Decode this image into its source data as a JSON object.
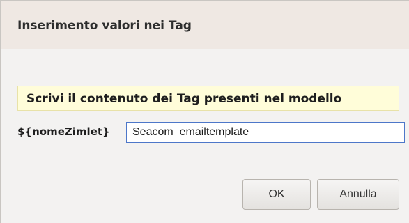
{
  "dialog": {
    "title": "Inserimento valori nei Tag",
    "hint": "Scrivi il contenuto dei Tag presenti nel modello",
    "field": {
      "label": "${nomeZimlet}",
      "value": "Seacom_emailtemplate"
    },
    "buttons": {
      "ok_label": "OK",
      "cancel_label": "Annulla"
    }
  }
}
